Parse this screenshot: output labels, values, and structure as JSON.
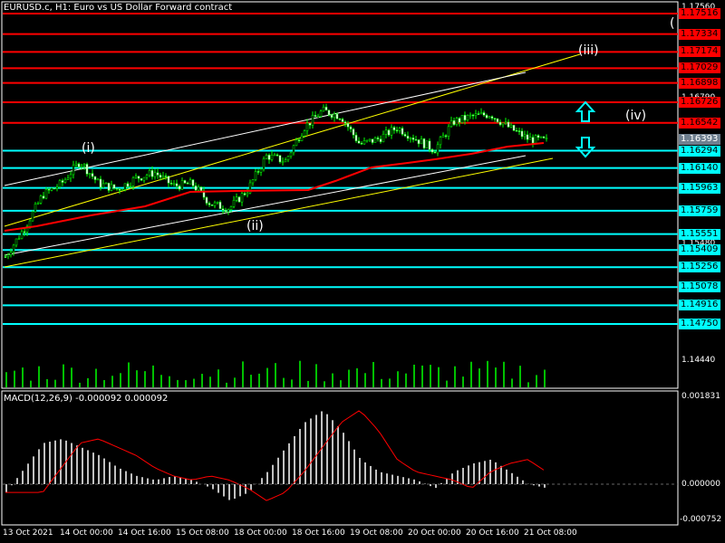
{
  "title": "EURUSD.c, H1:  Euro vs US Dollar Forward contract",
  "macd_title": "MACD(12,26,9) -0.000092 0.000092",
  "colors": {
    "red_level": "#ff0000",
    "cyan_level": "#00ffff",
    "current": "#6f7f8f",
    "ma": "#ff0000",
    "channel_yellow": "#ffff00",
    "channel_white": "#ffffff",
    "candles": "#00ff00",
    "arrow": "#00ffff"
  },
  "price_levels": [
    {
      "value": "1.17516",
      "type": "red"
    },
    {
      "value": "1.17334",
      "type": "red"
    },
    {
      "value": "1.17174",
      "type": "red"
    },
    {
      "value": "1.17029",
      "type": "red"
    },
    {
      "value": "1.16898",
      "type": "red"
    },
    {
      "value": "1.16726",
      "type": "red"
    },
    {
      "value": "1.16542",
      "type": "red"
    },
    {
      "value": "1.16393",
      "type": "current"
    },
    {
      "value": "1.16294",
      "type": "cyan"
    },
    {
      "value": "1.16140",
      "type": "cyan"
    },
    {
      "value": "1.15963",
      "type": "cyan"
    },
    {
      "value": "1.15759",
      "type": "cyan"
    },
    {
      "value": "1.15551",
      "type": "cyan"
    },
    {
      "value": "1.15409",
      "type": "cyan"
    },
    {
      "value": "1.15256",
      "type": "cyan"
    },
    {
      "value": "1.15078",
      "type": "cyan"
    },
    {
      "value": "1.14916",
      "type": "cyan"
    },
    {
      "value": "1.14750",
      "type": "cyan"
    }
  ],
  "axis_labels": [
    "1.17560",
    "1.16790",
    "1.15480",
    "1.14440"
  ],
  "macd_axis": [
    "0.001831",
    "0.000000",
    "-0.000752"
  ],
  "time_labels": [
    "13 Oct 2021",
    "14 Oct 00:00",
    "14 Oct 16:00",
    "15 Oct 08:00",
    "18 Oct 00:00",
    "18 Oct 16:00",
    "19 Oct 08:00",
    "20 Oct 00:00",
    "20 Oct 16:00",
    "21 Oct 08:00"
  ],
  "wave_labels": {
    "i": "(i)",
    "ii": "(ii)",
    "iii": "(iii)",
    "iv": "(iv)",
    "edge": "("
  },
  "price_path": [
    1.1535,
    1.156,
    1.159,
    1.16,
    1.162,
    1.16,
    1.1595,
    1.1605,
    1.161,
    1.1598,
    1.16,
    1.1582,
    1.1578,
    1.1595,
    1.1625,
    1.162,
    1.165,
    1.1665,
    1.166,
    1.1635,
    1.164,
    1.165,
    1.164,
    1.163,
    1.1655,
    1.166,
    1.1662,
    1.165,
    1.164,
    1.1638
  ],
  "macd_values": [
    -0.0002,
    0.0004,
    0.001,
    0.0011,
    0.0009,
    0.0007,
    0.0004,
    0.0002,
    0.0001,
    0.0002,
    0.0001,
    -0.0001,
    -0.0004,
    -0.0002,
    0.0003,
    0.0009,
    0.0015,
    0.0018,
    0.0013,
    0.0006,
    0.0003,
    0.0002,
    0.0001,
    -0.0001,
    0.0003,
    0.0005,
    0.0006,
    0.0003,
    0.0,
    -0.0001
  ]
}
